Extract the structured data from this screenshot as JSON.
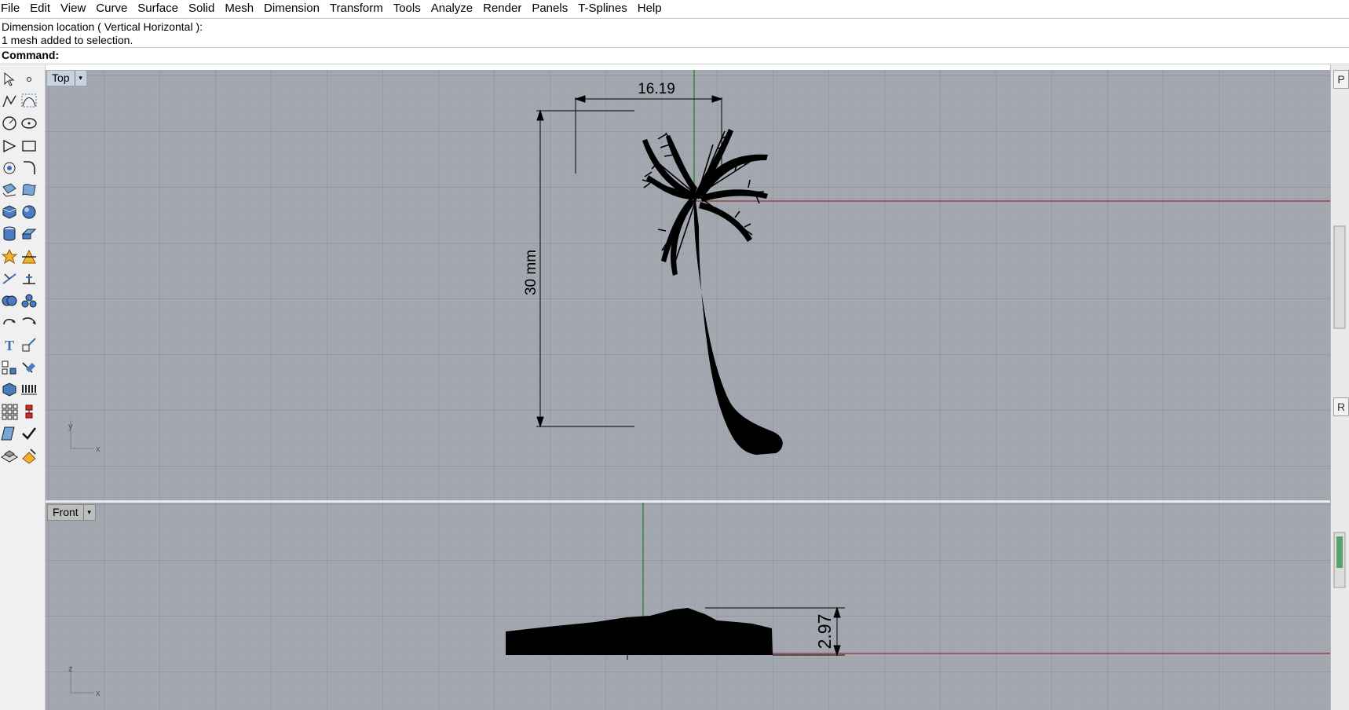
{
  "menu": [
    "File",
    "Edit",
    "View",
    "Curve",
    "Surface",
    "Solid",
    "Mesh",
    "Dimension",
    "Transform",
    "Tools",
    "Analyze",
    "Render",
    "Panels",
    "T-Splines",
    "Help"
  ],
  "command_history": [
    "Dimension location ( Vertical  Horizontal ):",
    "1 mesh added to selection."
  ],
  "command": {
    "label": "Command:",
    "value": ""
  },
  "toolbar_icons": [
    [
      "select-arrow-icon",
      "point-icon"
    ],
    [
      "polyline-icon",
      "curve-control-points-icon"
    ],
    [
      "circle-icon",
      "ellipse-icon"
    ],
    [
      "polygon-icon",
      "rectangle-icon"
    ],
    [
      "offset-curve-icon",
      "fillet-curve-icon"
    ],
    [
      "surface-from-points-icon",
      "loft-icon"
    ],
    [
      "box-icon",
      "sphere-icon"
    ],
    [
      "cylinder-icon",
      "extrude-surface-icon"
    ],
    [
      "explode-icon",
      "split-icon"
    ],
    [
      "trim-icon",
      "extend-icon"
    ],
    [
      "boolean-union-icon",
      "boolean-split-icon"
    ],
    [
      "rotate-icon",
      "rotate-3d-icon"
    ],
    [
      "text-icon",
      "scale-icon"
    ],
    [
      "group-icon",
      "align-icon"
    ],
    [
      "block-icon",
      "array-linear-icon"
    ],
    [
      "array-icon",
      "mirror-icon"
    ],
    [
      "move-icon",
      "check-icon"
    ],
    [
      "layer-icon",
      "render-icon"
    ]
  ],
  "viewports": [
    {
      "name": "Top",
      "axes": [
        "y",
        "x"
      ],
      "dimensions": {
        "width": "16.19",
        "height": "30 mm"
      }
    },
    {
      "name": "Front",
      "axes": [
        "z",
        "x"
      ],
      "dimensions": {
        "height": "2.97"
      }
    }
  ],
  "right_tabs": [
    "P",
    "R"
  ],
  "colors": {
    "grid_bg": "#a3a8b0",
    "x_axis": "#9d2b2b",
    "y_axis": "#2e8b2e",
    "model": "#000000"
  }
}
